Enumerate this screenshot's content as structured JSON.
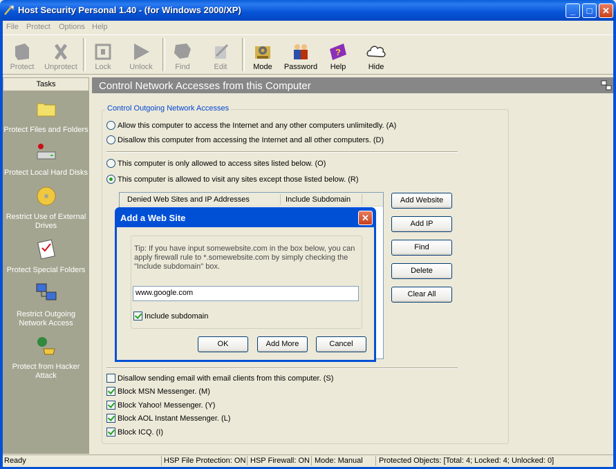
{
  "window": {
    "title": "Host Security Personal 1.40 - (for Windows 2000/XP)",
    "min": "_",
    "max": "□",
    "close": "✕"
  },
  "menu": [
    "File",
    "Protect",
    "Options",
    "Help"
  ],
  "toolbar": {
    "protect": "Protect",
    "unprotect": "Unprotect",
    "lock": "Lock",
    "unlock": "Unlock",
    "find": "Find",
    "edit": "Edit",
    "mode": "Mode",
    "password": "Password",
    "help": "Help",
    "hide": "Hide"
  },
  "tasks": {
    "header": "Tasks",
    "items": [
      "Protect Files and Folders",
      "Protect Local Hard Disks",
      "Restrict Use of External Drives",
      "Protect Special Folders",
      "Restrict Outgoing Network Access",
      "Protect from Hacker Attack"
    ]
  },
  "main": {
    "header": "Control Network Accesses from this Computer",
    "group_caption": "Control Outgoing Network Accesses",
    "radio_a": "Allow this computer to access the Internet and any other computers unlimitedly. (A)",
    "radio_d": "Disallow this computer from accessing the Internet and all other computers. (D)",
    "radio_o": "This computer is only allowed to access sites listed below. (O)",
    "radio_r": "This computer is allowed to visit any sites except those listed below. (R)",
    "selected_radio": "R",
    "list_col1": "Denied Web Sites and IP Addresses",
    "list_col2": "Include Subdomain",
    "btn_add_website": "Add Website",
    "btn_add_ip": "Add IP",
    "btn_find": "Find",
    "btn_delete": "Delete",
    "btn_clear_all": "Clear All",
    "check_email": "Disallow sending email with email clients from this computer. (S)",
    "check_msn": "Block MSN Messenger. (M)",
    "check_yahoo": "Block Yahoo! Messenger. (Y)",
    "check_aol": "Block AOL Instant Messenger. (L)",
    "check_icq": "Block ICQ. (I)",
    "checks_state": {
      "email": false,
      "msn": true,
      "yahoo": true,
      "aol": true,
      "icq": true
    }
  },
  "dialog": {
    "title": "Add a Web Site",
    "tip": "Tip: If you have input somewebsite.com in the box below, you can apply firewall rule to *.somewebsite.com by simply checking the \"Include subdomain\" box.",
    "input_value": "www.google.com",
    "include_subdomain_label": "Include subdomain",
    "include_subdomain": true,
    "ok": "OK",
    "add_more": "Add More",
    "cancel": "Cancel"
  },
  "status": {
    "ready": "Ready",
    "file_protection": "HSP File Protection: ON",
    "firewall": "HSP Firewall: ON",
    "mode": "Mode: Manual",
    "protected": "Protected Objects: [Total: 4; Locked: 4; Unlocked: 0]"
  },
  "colors": {
    "titlebar": "#0a5fd9",
    "tasks_pane": "#a4a590",
    "panel_header": "#878787",
    "group_caption": "#0046d5",
    "check_mark": "#21a121"
  }
}
